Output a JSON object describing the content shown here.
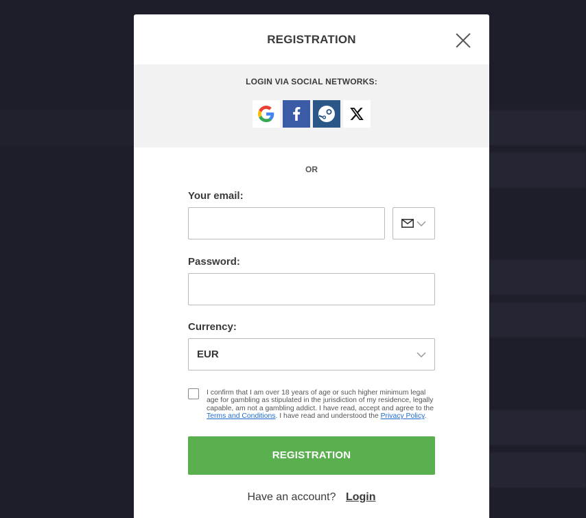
{
  "modal": {
    "title": "REGISTRATION",
    "close_icon": "close-icon"
  },
  "social": {
    "title": "LOGIN VIA SOCIAL NETWORKS:",
    "providers": [
      {
        "name": "google",
        "icon": "google-icon",
        "color": "#ffffff"
      },
      {
        "name": "facebook",
        "icon": "facebook-icon",
        "color": "#3b5ba7"
      },
      {
        "name": "steam",
        "icon": "steam-icon",
        "color": "#2a5688"
      },
      {
        "name": "x",
        "icon": "x-icon",
        "color": "#ffffff"
      }
    ]
  },
  "separator": "OR",
  "form": {
    "email_label": "Your email:",
    "email_value": "",
    "contact_method_icon": "envelope-icon",
    "password_label": "Password:",
    "password_value": "",
    "currency_label": "Currency:",
    "currency_value": "EUR",
    "consent_checked": false,
    "consent_text_1": "I confirm that I am over 18 years of age or such higher minimum legal age for gambling as stipulated in the jurisdiction of my residence, legally capable, am not a gambling addict. I have read, accept and agree to the ",
    "terms_link": "Terms and Conditions",
    "consent_text_2": ". I have read and understood the ",
    "privacy_link": "Privacy Policy",
    "consent_text_3": ".",
    "submit_label": "REGISTRATION",
    "submit_color": "#5aaf4f",
    "account_question": "Have an account?",
    "login_link": "Login"
  }
}
